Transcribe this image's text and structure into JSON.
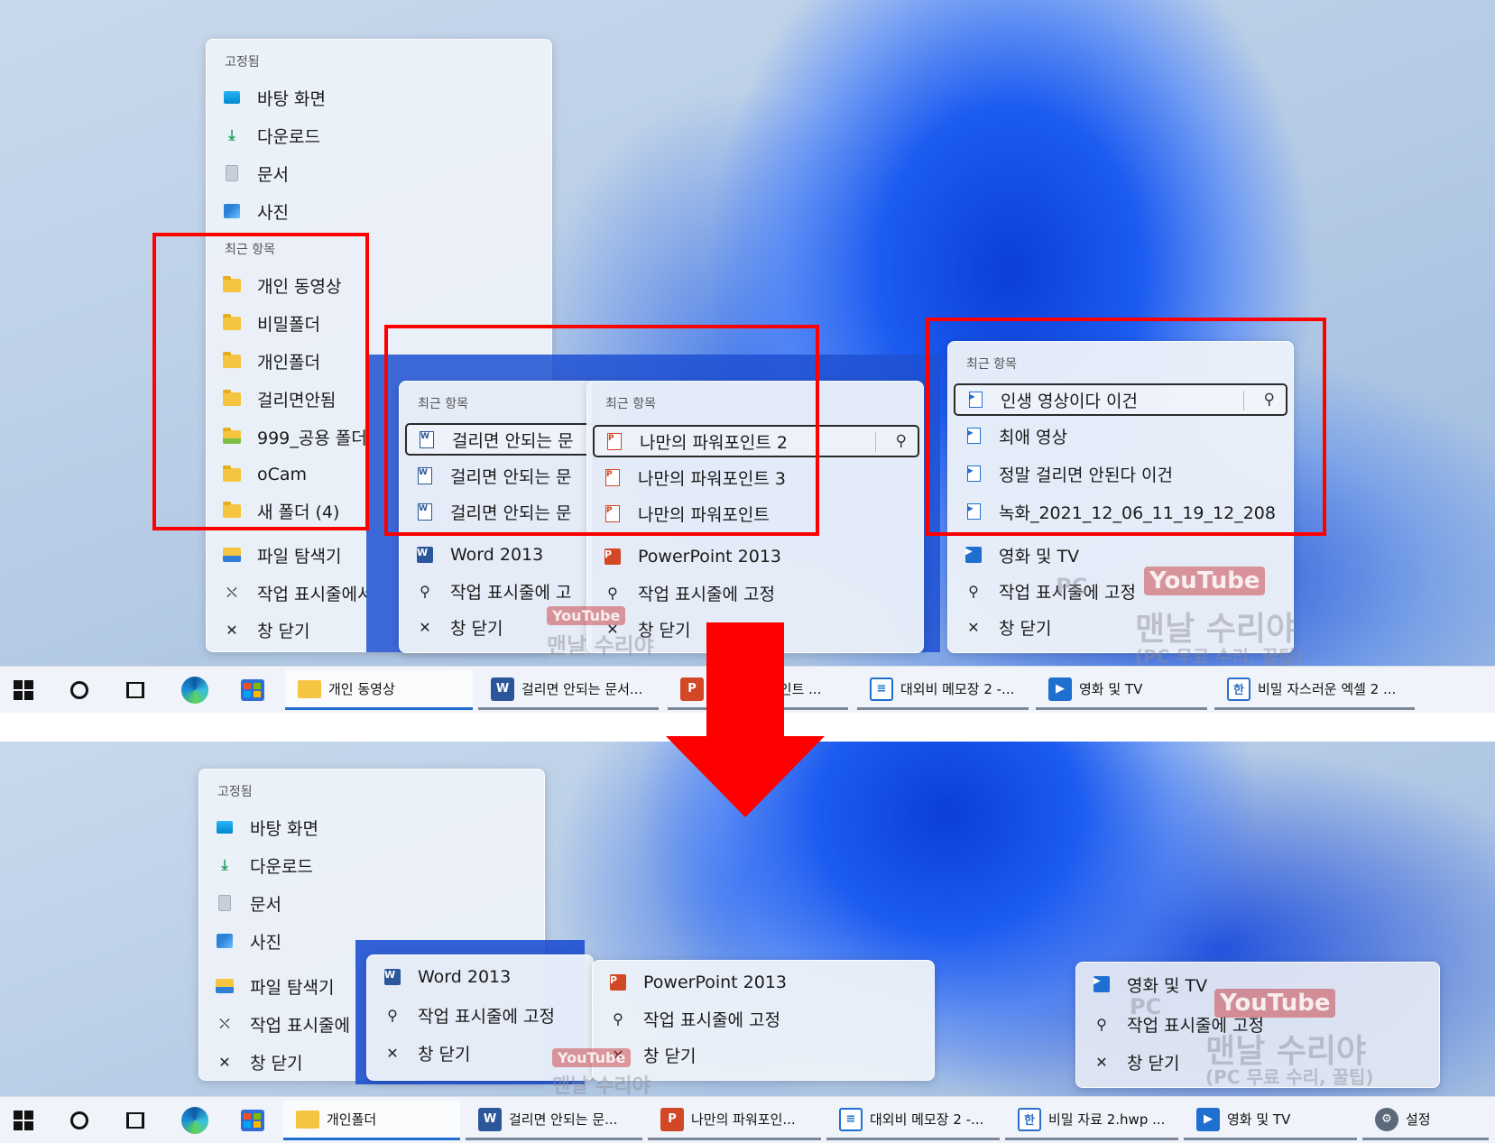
{
  "common": {
    "pinned_header": "고정됨",
    "recent_header": "최근 항목",
    "pin_to_taskbar": "작업 표시줄에 고정",
    "close_window": "창 닫기",
    "watermark": {
      "youtube": "YouTube",
      "channel": "맨날 수리야",
      "sub": "(PC 무료 수리, 꿀팁)",
      "pc": "PC"
    }
  },
  "explorer": {
    "pinned": [
      {
        "label": "바탕 화면",
        "icon": "desktop-icon"
      },
      {
        "label": "다운로드",
        "icon": "download-icon"
      },
      {
        "label": "문서",
        "icon": "documents-icon"
      },
      {
        "label": "사진",
        "icon": "pictures-icon"
      }
    ],
    "recent": [
      {
        "label": "개인 동영상"
      },
      {
        "label": "비밀폴더"
      },
      {
        "label": "개인폴더"
      },
      {
        "label": "걸리면안됨"
      },
      {
        "label": "999_공용 폴더"
      },
      {
        "label": "oCam"
      },
      {
        "label": "새 폴더 (4)"
      }
    ],
    "app": "파일 탐색기",
    "unpin_top": "작업 표시줄에서",
    "unpin_bottom": "작업 표시줄에"
  },
  "word": {
    "recent": [
      "걸리면 안되는 문",
      "걸리면 안되는 문",
      "걸리면 안되는 문"
    ],
    "app": "Word 2013",
    "pin_top": "작업 표시줄에 고"
  },
  "ppt": {
    "recent": [
      "나만의 파워포인트 2",
      "나만의 파워포인트 3",
      "나만의 파워포인트"
    ],
    "app": "PowerPoint 2013"
  },
  "movies": {
    "recent": [
      "인생 영상이다 이건",
      "최애 영상",
      "정말 걸리면 안된다 이건",
      "녹화_2021_12_06_11_19_12_208"
    ],
    "app": "영화 및 TV"
  },
  "taskbar_top": [
    {
      "label": "개인 동영상",
      "icon": "folder"
    },
    {
      "label": "걸리면 안되는 문서...",
      "icon": "word"
    },
    {
      "label": "포인트 ...",
      "icon": "ppt"
    },
    {
      "label": "대외비 메모장 2 -...",
      "icon": "memo"
    },
    {
      "label": "영화 및 TV",
      "icon": "movie"
    },
    {
      "label": "비밀 자스러운 엑셀 2 ...",
      "icon": "hwp"
    }
  ],
  "taskbar_bottom": [
    {
      "label": "개인폴더",
      "icon": "folder"
    },
    {
      "label": "걸리면 안되는 문...",
      "icon": "word"
    },
    {
      "label": "나만의 파워포인...",
      "icon": "ppt"
    },
    {
      "label": "대외비 메모장 2 -...",
      "icon": "memo"
    },
    {
      "label": "비밀 자료 2.hwp ...",
      "icon": "hwp"
    },
    {
      "label": "영화 및 TV",
      "icon": "movie"
    },
    {
      "label": "설정",
      "icon": "gear"
    }
  ],
  "icon_glyphs": {
    "word": "W",
    "ppt": "P",
    "memo": "≡",
    "movie": "▶",
    "hwp": "한",
    "gear": "⚙",
    "folder": ""
  },
  "colors": {
    "highlight_red": "#ff0000",
    "word_blue": "#2b579a",
    "ppt_red": "#d24726",
    "movie_blue": "#1f6fd1"
  }
}
